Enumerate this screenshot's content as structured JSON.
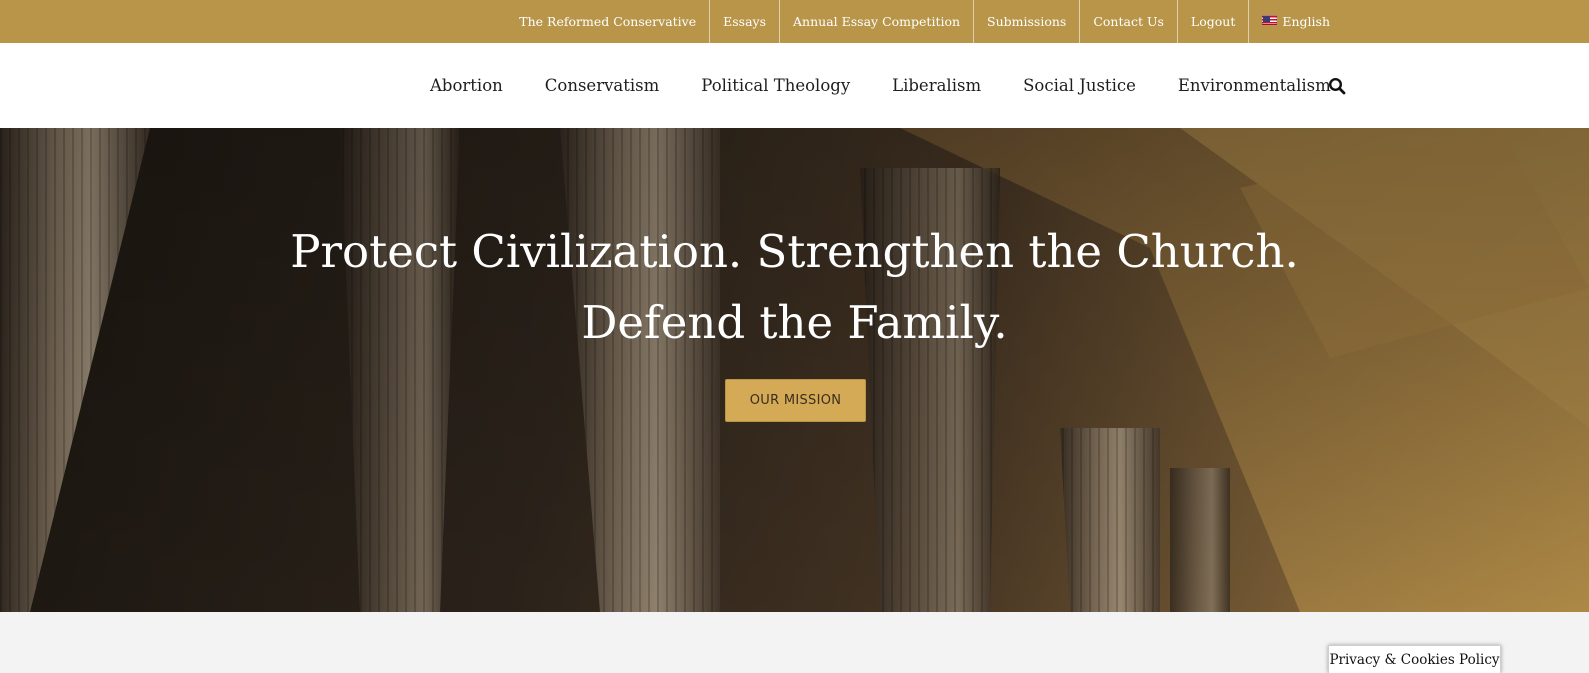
{
  "colors": {
    "topbar_bg": "#b89549",
    "mission_button_bg": "#d4aa57",
    "nav_bg": "#ffffff",
    "page_bg": "#f3f3f3"
  },
  "topbar": {
    "items": [
      {
        "label": "The Reformed Conservative"
      },
      {
        "label": "Essays"
      },
      {
        "label": "Annual Essay Competition"
      },
      {
        "label": "Submissions"
      },
      {
        "label": "Contact Us"
      },
      {
        "label": "Logout"
      },
      {
        "label": "English",
        "icon": "us-flag-icon"
      }
    ]
  },
  "mainnav": {
    "items": [
      {
        "label": "Abortion"
      },
      {
        "label": "Conservatism"
      },
      {
        "label": "Political Theology"
      },
      {
        "label": "Liberalism"
      },
      {
        "label": "Social Justice"
      },
      {
        "label": "Environmentalism"
      }
    ],
    "search_icon": "search-icon"
  },
  "hero": {
    "title_line1": "Protect Civilization. Strengthen the Church.",
    "title_line2": "Defend the Family.",
    "button_label": "OUR MISSION"
  },
  "cookie": {
    "label": "Privacy & Cookies Policy"
  }
}
